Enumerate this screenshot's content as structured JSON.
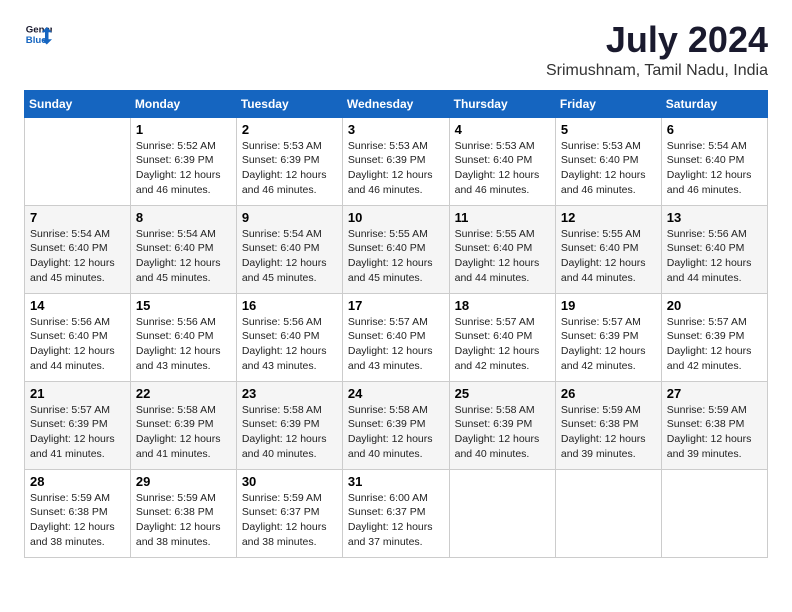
{
  "logo": {
    "line1": "General",
    "line2": "Blue"
  },
  "title": "July 2024",
  "subtitle": "Srimushnam, Tamil Nadu, India",
  "headers": [
    "Sunday",
    "Monday",
    "Tuesday",
    "Wednesday",
    "Thursday",
    "Friday",
    "Saturday"
  ],
  "weeks": [
    [
      {
        "num": "",
        "empty": true
      },
      {
        "num": "1",
        "sunrise": "5:52 AM",
        "sunset": "6:39 PM",
        "daylight": "12 hours and 46 minutes."
      },
      {
        "num": "2",
        "sunrise": "5:53 AM",
        "sunset": "6:39 PM",
        "daylight": "12 hours and 46 minutes."
      },
      {
        "num": "3",
        "sunrise": "5:53 AM",
        "sunset": "6:39 PM",
        "daylight": "12 hours and 46 minutes."
      },
      {
        "num": "4",
        "sunrise": "5:53 AM",
        "sunset": "6:40 PM",
        "daylight": "12 hours and 46 minutes."
      },
      {
        "num": "5",
        "sunrise": "5:53 AM",
        "sunset": "6:40 PM",
        "daylight": "12 hours and 46 minutes."
      },
      {
        "num": "6",
        "sunrise": "5:54 AM",
        "sunset": "6:40 PM",
        "daylight": "12 hours and 46 minutes."
      }
    ],
    [
      {
        "num": "7",
        "sunrise": "5:54 AM",
        "sunset": "6:40 PM",
        "daylight": "12 hours and 45 minutes."
      },
      {
        "num": "8",
        "sunrise": "5:54 AM",
        "sunset": "6:40 PM",
        "daylight": "12 hours and 45 minutes."
      },
      {
        "num": "9",
        "sunrise": "5:54 AM",
        "sunset": "6:40 PM",
        "daylight": "12 hours and 45 minutes."
      },
      {
        "num": "10",
        "sunrise": "5:55 AM",
        "sunset": "6:40 PM",
        "daylight": "12 hours and 45 minutes."
      },
      {
        "num": "11",
        "sunrise": "5:55 AM",
        "sunset": "6:40 PM",
        "daylight": "12 hours and 44 minutes."
      },
      {
        "num": "12",
        "sunrise": "5:55 AM",
        "sunset": "6:40 PM",
        "daylight": "12 hours and 44 minutes."
      },
      {
        "num": "13",
        "sunrise": "5:56 AM",
        "sunset": "6:40 PM",
        "daylight": "12 hours and 44 minutes."
      }
    ],
    [
      {
        "num": "14",
        "sunrise": "5:56 AM",
        "sunset": "6:40 PM",
        "daylight": "12 hours and 44 minutes."
      },
      {
        "num": "15",
        "sunrise": "5:56 AM",
        "sunset": "6:40 PM",
        "daylight": "12 hours and 43 minutes."
      },
      {
        "num": "16",
        "sunrise": "5:56 AM",
        "sunset": "6:40 PM",
        "daylight": "12 hours and 43 minutes."
      },
      {
        "num": "17",
        "sunrise": "5:57 AM",
        "sunset": "6:40 PM",
        "daylight": "12 hours and 43 minutes."
      },
      {
        "num": "18",
        "sunrise": "5:57 AM",
        "sunset": "6:40 PM",
        "daylight": "12 hours and 42 minutes."
      },
      {
        "num": "19",
        "sunrise": "5:57 AM",
        "sunset": "6:39 PM",
        "daylight": "12 hours and 42 minutes."
      },
      {
        "num": "20",
        "sunrise": "5:57 AM",
        "sunset": "6:39 PM",
        "daylight": "12 hours and 42 minutes."
      }
    ],
    [
      {
        "num": "21",
        "sunrise": "5:57 AM",
        "sunset": "6:39 PM",
        "daylight": "12 hours and 41 minutes."
      },
      {
        "num": "22",
        "sunrise": "5:58 AM",
        "sunset": "6:39 PM",
        "daylight": "12 hours and 41 minutes."
      },
      {
        "num": "23",
        "sunrise": "5:58 AM",
        "sunset": "6:39 PM",
        "daylight": "12 hours and 40 minutes."
      },
      {
        "num": "24",
        "sunrise": "5:58 AM",
        "sunset": "6:39 PM",
        "daylight": "12 hours and 40 minutes."
      },
      {
        "num": "25",
        "sunrise": "5:58 AM",
        "sunset": "6:39 PM",
        "daylight": "12 hours and 40 minutes."
      },
      {
        "num": "26",
        "sunrise": "5:59 AM",
        "sunset": "6:38 PM",
        "daylight": "12 hours and 39 minutes."
      },
      {
        "num": "27",
        "sunrise": "5:59 AM",
        "sunset": "6:38 PM",
        "daylight": "12 hours and 39 minutes."
      }
    ],
    [
      {
        "num": "28",
        "sunrise": "5:59 AM",
        "sunset": "6:38 PM",
        "daylight": "12 hours and 38 minutes."
      },
      {
        "num": "29",
        "sunrise": "5:59 AM",
        "sunset": "6:38 PM",
        "daylight": "12 hours and 38 minutes."
      },
      {
        "num": "30",
        "sunrise": "5:59 AM",
        "sunset": "6:37 PM",
        "daylight": "12 hours and 38 minutes."
      },
      {
        "num": "31",
        "sunrise": "6:00 AM",
        "sunset": "6:37 PM",
        "daylight": "12 hours and 37 minutes."
      },
      {
        "num": "",
        "empty": true
      },
      {
        "num": "",
        "empty": true
      },
      {
        "num": "",
        "empty": true
      }
    ]
  ]
}
